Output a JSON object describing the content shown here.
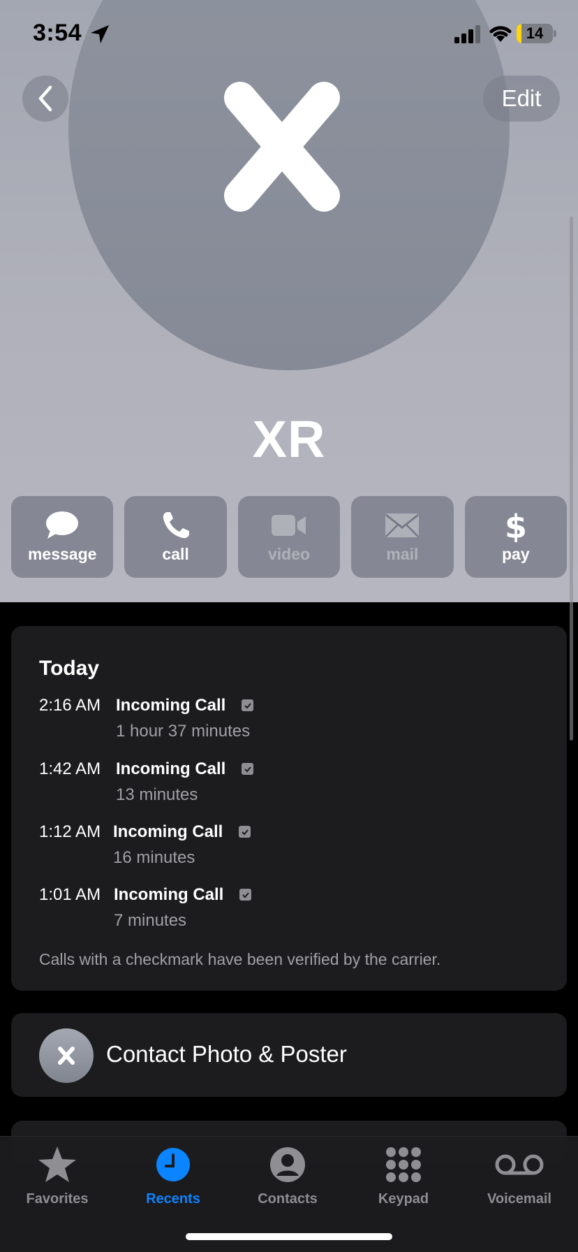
{
  "status_bar": {
    "time": "3:54",
    "battery": "14",
    "battery_level": 0.14,
    "battery_color": "#ffd60a",
    "icons": [
      "location-arrow-icon",
      "cellular-signal-icon",
      "wifi-icon",
      "battery-icon"
    ]
  },
  "nav": {
    "back_icon": "chevron-left-icon",
    "edit_label": "Edit"
  },
  "contact": {
    "initial": "X",
    "name": "XR",
    "avatar_color": "#8a8f9a"
  },
  "actions": [
    {
      "label": "message",
      "icon": "message-bubble-icon",
      "enabled": true
    },
    {
      "label": "call",
      "icon": "phone-icon",
      "enabled": true
    },
    {
      "label": "video",
      "icon": "video-camera-icon",
      "enabled": false
    },
    {
      "label": "mail",
      "icon": "envelope-icon",
      "enabled": false
    },
    {
      "label": "pay",
      "icon": "dollar-sign-icon",
      "enabled": true
    }
  ],
  "calls": {
    "section_title": "Today",
    "items": [
      {
        "time": "2:16 AM",
        "type": "Incoming Call",
        "duration": "1 hour 37 minutes",
        "verified": true
      },
      {
        "time": "1:42 AM",
        "type": "Incoming Call",
        "duration": "13 minutes",
        "verified": true
      },
      {
        "time": "1:12 AM",
        "type": "Incoming Call",
        "duration": "16 minutes",
        "verified": true
      },
      {
        "time": "1:01 AM",
        "type": "Incoming Call",
        "duration": "7 minutes",
        "verified": true
      }
    ],
    "footnote": "Calls with a checkmark have been verified by the carrier."
  },
  "contact_photo": {
    "initial": "X",
    "label": "Contact Photo & Poster"
  },
  "tabbar": {
    "active_color": "#0a84ff",
    "tabs": [
      {
        "label": "Favorites",
        "icon": "star-icon",
        "active": false
      },
      {
        "label": "Recents",
        "icon": "clock-icon",
        "active": true
      },
      {
        "label": "Contacts",
        "icon": "person-circle-icon",
        "active": false
      },
      {
        "label": "Keypad",
        "icon": "keypad-grid-icon",
        "active": false
      },
      {
        "label": "Voicemail",
        "icon": "voicemail-icon",
        "active": false
      }
    ]
  }
}
